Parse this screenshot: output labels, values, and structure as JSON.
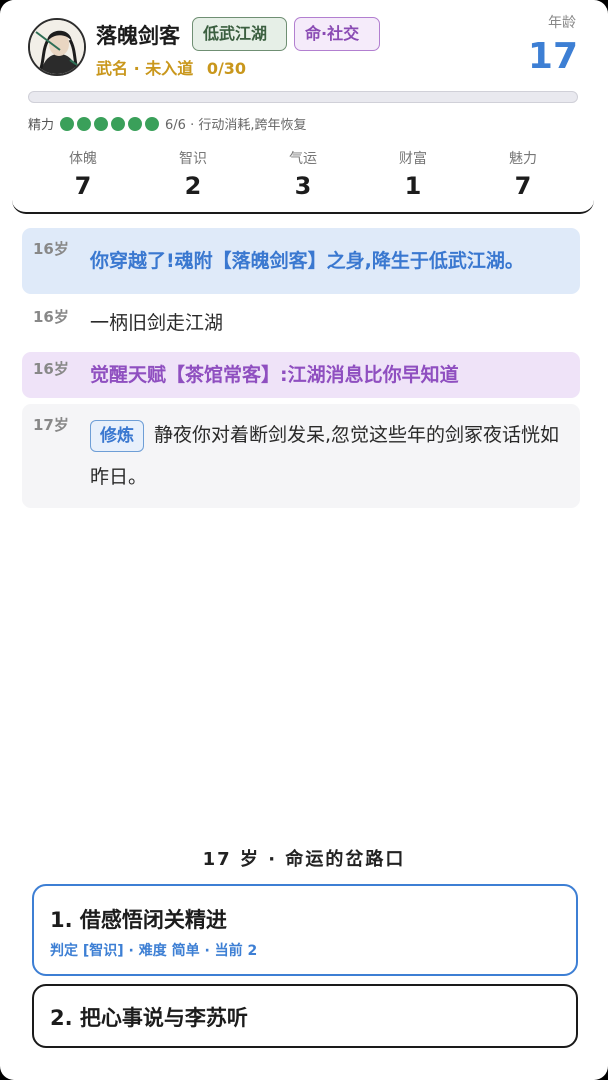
{
  "header": {
    "name": "落魄剑客",
    "world_tag": "低武江湖",
    "fate_tag": "命·社交",
    "rank": "武名 · 未入道",
    "rank_progress": "0/30",
    "rank_progress_fraction": 0.0,
    "age_label": "年龄",
    "age_value": "17",
    "energy_label": "精力",
    "energy_filled": 6,
    "energy_total": 6,
    "energy_info": "6/6 · 行动消耗,跨年恢复",
    "avatar_icon": "swordsman-portrait-icon"
  },
  "stats": [
    {
      "label": "体魄",
      "value": "7"
    },
    {
      "label": "智识",
      "value": "2"
    },
    {
      "label": "气运",
      "value": "3"
    },
    {
      "label": "财富",
      "value": "1"
    },
    {
      "label": "魅力",
      "value": "7"
    }
  ],
  "log": [
    {
      "age": "16岁",
      "text": "你穿越了!魂附【落魄剑客】之身,降生于低武江湖。"
    },
    {
      "age": "16岁",
      "text": "一柄旧剑走江湖"
    },
    {
      "age": "16岁",
      "text": "觉醒天赋【茶馆常客】:江湖消息比你早知道"
    },
    {
      "age": "17岁",
      "badge": "修炼",
      "text": "静夜你对着断剑发呆,忽觉这些年的剑冢夜话恍如昨日。"
    }
  ],
  "crossroads_title": "17 岁 · 命运的岔路口",
  "choices": [
    {
      "title": "1. 借感悟闭关精进",
      "sub": "判定 [智识] · 难度 简单 · 当前 2"
    },
    {
      "title": "2. 把心事说与李苏听"
    }
  ],
  "colors": {
    "accent_blue": "#3d7fd4",
    "gold": "#c9971c",
    "purple": "#8f4fc0",
    "energy_green": "#3aa05a"
  }
}
